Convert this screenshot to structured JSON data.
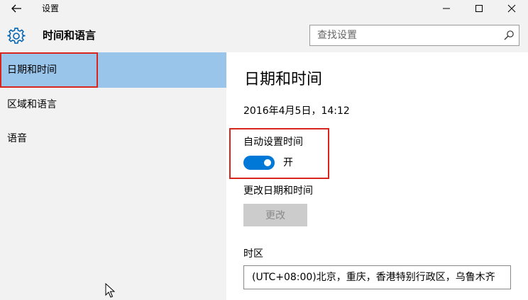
{
  "window": {
    "title": "设置"
  },
  "header": {
    "section_title": "时间和语言",
    "search_placeholder": "查找设置"
  },
  "sidebar": {
    "items": [
      {
        "label": "日期和时间",
        "selected": true
      },
      {
        "label": "区域和语言",
        "selected": false
      },
      {
        "label": "语音",
        "selected": false
      }
    ]
  },
  "main": {
    "heading": "日期和时间",
    "current_datetime": "2016年4月5日，14:12",
    "auto_time": {
      "label": "自动设置时间",
      "state": "开",
      "on": true
    },
    "change_datetime": {
      "label": "更改日期和时间",
      "button": "更改"
    },
    "timezone": {
      "label": "时区",
      "value": "(UTC+08:00)北京，重庆，香港特别行政区，乌鲁木齐"
    }
  },
  "colors": {
    "accent": "#0078d7",
    "selected_bg": "#99c5eb",
    "highlight_border": "#d7261e",
    "chrome_bg": "#f2f2f2"
  }
}
